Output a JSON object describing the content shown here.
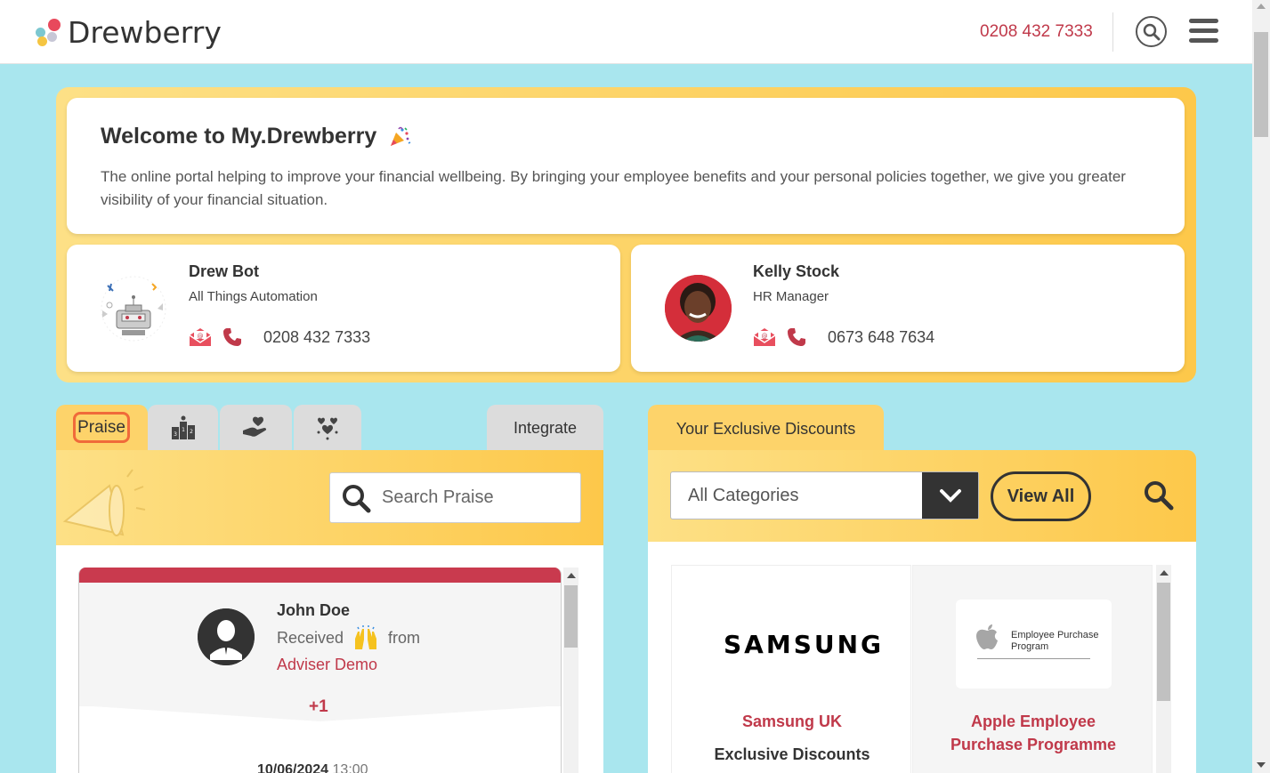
{
  "header": {
    "logo_text": "Drewberry",
    "phone": "0208 432 7333",
    "search_icon": "search-icon",
    "menu_icon": "hamburger-menu-icon"
  },
  "welcome": {
    "title": "Welcome to My.Drewberry",
    "text": "The online portal helping to improve your financial wellbeing. By bringing your employee benefits and your personal policies together, we give you greater visibility of your financial situation."
  },
  "contacts": [
    {
      "name": "Drew Bot",
      "role": "All Things Automation",
      "phone": "0208 432 7333"
    },
    {
      "name": "Kelly Stock",
      "role": "HR Manager",
      "phone": "0673 648 7634"
    }
  ],
  "praise_panel": {
    "tabs": {
      "praise": "Praise",
      "integrate": "Integrate"
    },
    "search_placeholder": "Search Praise",
    "card": {
      "name": "John Doe",
      "received": "Received",
      "from": "from",
      "from_name": "Adviser Demo",
      "plus": "+1",
      "date": "10/06/2024",
      "time": "13:00"
    }
  },
  "discounts_panel": {
    "tab": "Your Exclusive Discounts",
    "category_selected": "All Categories",
    "view_all": "View All",
    "items": [
      {
        "logo": "SAMSUNG",
        "title": "Samsung UK",
        "subtitle": "Exclusive Discounts"
      },
      {
        "logo_text": "Employee Purchase Program",
        "title_line1": "Apple Employee",
        "title_line2": "Purchase Programme"
      }
    ]
  },
  "colors": {
    "accent_red": "#c0394a",
    "band_yellow": "#fdc84a",
    "page_bg": "#a9e6ee"
  }
}
